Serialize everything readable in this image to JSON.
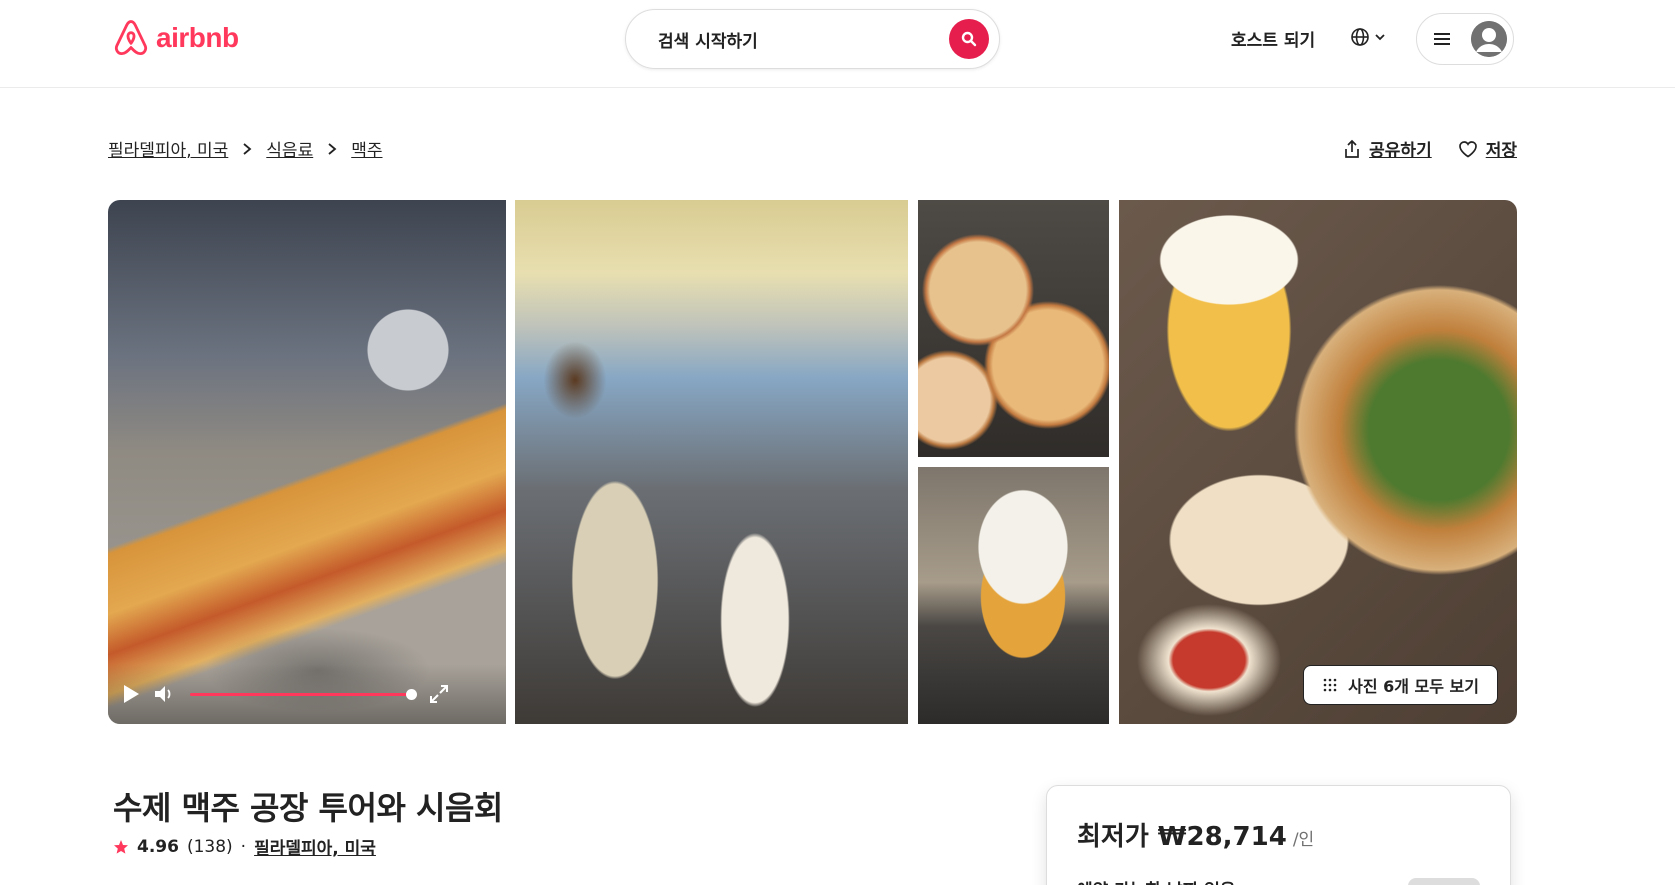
{
  "header": {
    "logo_text": "airbnb",
    "search_placeholder": "검색 시작하기",
    "host_link": "호스트 되기",
    "brand_color": "#ff385c"
  },
  "breadcrumb": {
    "items": [
      "필라델피아, 미국",
      "식음료",
      "맥주"
    ]
  },
  "actions": {
    "share": "공유하기",
    "save": "저장"
  },
  "gallery": {
    "show_all": "사진 6개 모두 보기",
    "video_progress": 1.0
  },
  "listing": {
    "title": "수제 맥주 공장 투어와 시음회",
    "rating": "4.96",
    "reviews": "(138)",
    "separator": "·",
    "location": "필라델피아, 미국"
  },
  "booking": {
    "price": "최저가 ₩28,714",
    "per": "/인",
    "availability": "예약 가능한 날짜 없음"
  }
}
